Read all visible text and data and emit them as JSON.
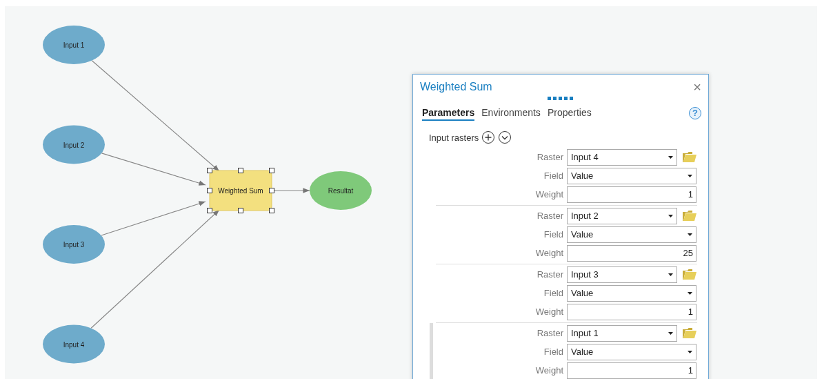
{
  "diagram": {
    "nodes": [
      {
        "label": "Input 1",
        "kind": "input",
        "selected": false
      },
      {
        "label": "Input 2",
        "kind": "input",
        "selected": false
      },
      {
        "label": "Input 3",
        "kind": "input",
        "selected": false
      },
      {
        "label": "Input 4",
        "kind": "input",
        "selected": false
      },
      {
        "label": "Weighted Sum",
        "kind": "tool",
        "selected": true
      },
      {
        "label": "Resultat",
        "kind": "output",
        "selected": false
      }
    ]
  },
  "dialog": {
    "title": "Weighted Sum",
    "close": "×",
    "help": "?",
    "tabs": [
      {
        "label": "Parameters",
        "selected": true
      },
      {
        "label": "Environments",
        "selected": false
      },
      {
        "label": "Properties",
        "selected": false
      }
    ],
    "section_label": "Input rasters",
    "groups": [
      {
        "raster_label": "Raster",
        "raster": "Input 4",
        "field_label": "Field",
        "field": "Value",
        "weight_label": "Weight",
        "weight": "1",
        "selected": false
      },
      {
        "raster_label": "Raster",
        "raster": "Input 2",
        "field_label": "Field",
        "field": "Value",
        "weight_label": "Weight",
        "weight": "25",
        "selected": false
      },
      {
        "raster_label": "Raster",
        "raster": "Input 3",
        "field_label": "Field",
        "field": "Value",
        "weight_label": "Weight",
        "weight": "1",
        "selected": false
      },
      {
        "raster_label": "Raster",
        "raster": "Input 1",
        "field_label": "Field",
        "field": "Value",
        "weight_label": "Weight",
        "weight": "1",
        "selected": true
      }
    ]
  }
}
